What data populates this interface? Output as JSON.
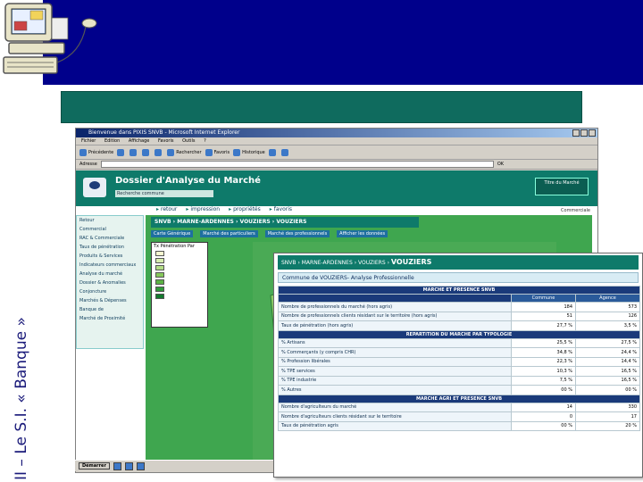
{
  "slide": {
    "vertical_title": "II – Le S.I. « Banque »"
  },
  "browser": {
    "title": "Bienvenue dans PIXIS SNVB - Microsoft Internet Explorer",
    "menu": [
      "Fichier",
      "Edition",
      "Affichage",
      "Favoris",
      "Outils",
      "?"
    ],
    "toolbar": [
      "Précédente",
      "Rechercher",
      "Favoris",
      "Historique"
    ],
    "address_label": "Adresse",
    "address_value": "",
    "go_label": "OK",
    "statusbar": ""
  },
  "page": {
    "title": "Dossier d'Analyse du Marché",
    "search_placeholder": "Recherche commune",
    "right_box": "Titre du Marché",
    "corner_text": "Commerciale",
    "nav": [
      "retour",
      "impression",
      "propriétés",
      "favoris"
    ],
    "sidebar": [
      "Retour",
      "Commercial",
      "RAC & Commerciale",
      "Taux de pénétration",
      "Produits & Services",
      "Indicateurs commerciaux",
      "Analyse du marché",
      "Dossier & Anomalies",
      "Conjoncture",
      "Marchés & Dépenses",
      "Banque de",
      "Marché de Proximité"
    ],
    "map_breadcrumb": [
      "SNVB",
      "MARNE-ARDENNES",
      "VOUZIERS",
      "VOUZIERS"
    ],
    "map_tabs": [
      "Carte Générique",
      "Marché des particuliers",
      "Marché des professionnels",
      "Afficher les données"
    ],
    "legend_title": "Tx Pénétration Par",
    "legend_colors": [
      "#f6f7d0",
      "#d7ecae",
      "#b3dc86",
      "#86c85c",
      "#5bb244",
      "#2f9a3a",
      "#137a2e"
    ]
  },
  "panel": {
    "breadcrumb": [
      "SNVB",
      "MARNE-ARDENNES",
      "VOUZIERS",
      "VOUZIERS"
    ],
    "title": "Commune de VOUZIERS- Analyse Professionnelle",
    "col_commune": "Commune",
    "col_agence": "Agence",
    "sections": [
      {
        "title": "MARCHE ET PRESENCE SNVB",
        "rows": [
          {
            "label": "Nombre de professionnels du marché (hors agris)",
            "commune": "184",
            "agence": "573"
          },
          {
            "label": "Nombre de professionnels clients résidant sur le territoire (hors agris)",
            "commune": "51",
            "agence": "126"
          },
          {
            "label": "Taux de pénétration (hors agris)",
            "commune": "27,7 %",
            "agence": "3,5 %"
          }
        ]
      },
      {
        "title": "REPARTITION DU MARCHE PAR TYPOLOGIE",
        "rows": [
          {
            "label": "% Artisans",
            "commune": "25,5 %",
            "agence": "27,5 %"
          },
          {
            "label": "% Commerçants (y compris CHR)",
            "commune": "34,8 %",
            "agence": "24,4 %"
          },
          {
            "label": "% Profession libérales",
            "commune": "22,3 %",
            "agence": "14,4 %"
          },
          {
            "label": "% TPE services",
            "commune": "10,3 %",
            "agence": "16,5 %"
          },
          {
            "label": "% TPE industrie",
            "commune": "7,5 %",
            "agence": "16,5 %"
          },
          {
            "label": "% Autres",
            "commune": "00 %",
            "agence": "00 %"
          }
        ]
      },
      {
        "title": "MARCHE AGRI ET PRESENCE SNVB",
        "rows": [
          {
            "label": "Nombre d'agriculteurs du marché",
            "commune": "14",
            "agence": "330"
          },
          {
            "label": "Nombre d'agriculteurs clients résidant sur le territoire",
            "commune": "0",
            "agence": "17"
          },
          {
            "label": "Taux de pénétration agris",
            "commune": "00 %",
            "agence": "20 %"
          }
        ]
      }
    ]
  },
  "taskbar": {
    "start_label": "Démarrer"
  },
  "colors": {
    "slide_header": "#00008b",
    "teal_bar": "#0f6b5e",
    "map_green": "#3fa64f",
    "table_section": "#1a3a7a"
  }
}
